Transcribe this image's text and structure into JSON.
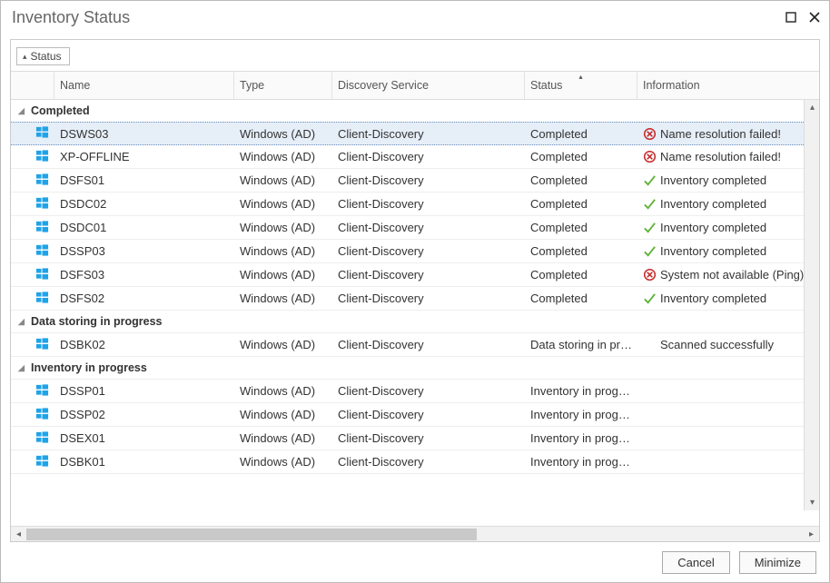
{
  "window": {
    "title": "Inventory Status"
  },
  "chip": {
    "label": "Status"
  },
  "columns": {
    "name": "Name",
    "type": "Type",
    "discovery": "Discovery Service",
    "status": "Status",
    "information": "Information"
  },
  "groups": [
    {
      "label": "Completed",
      "rows": [
        {
          "name": "DSWS03",
          "type": "Windows (AD)",
          "discovery": "Client-Discovery",
          "status": "Completed",
          "info_kind": "error",
          "info": "Name resolution failed!",
          "selected": true
        },
        {
          "name": "XP-OFFLINE",
          "type": "Windows (AD)",
          "discovery": "Client-Discovery",
          "status": "Completed",
          "info_kind": "error",
          "info": "Name resolution failed!"
        },
        {
          "name": "DSFS01",
          "type": "Windows (AD)",
          "discovery": "Client-Discovery",
          "status": "Completed",
          "info_kind": "ok",
          "info": "Inventory completed"
        },
        {
          "name": "DSDC02",
          "type": "Windows (AD)",
          "discovery": "Client-Discovery",
          "status": "Completed",
          "info_kind": "ok",
          "info": "Inventory completed"
        },
        {
          "name": "DSDC01",
          "type": "Windows (AD)",
          "discovery": "Client-Discovery",
          "status": "Completed",
          "info_kind": "ok",
          "info": "Inventory completed"
        },
        {
          "name": "DSSP03",
          "type": "Windows (AD)",
          "discovery": "Client-Discovery",
          "status": "Completed",
          "info_kind": "ok",
          "info": "Inventory completed"
        },
        {
          "name": "DSFS03",
          "type": "Windows (AD)",
          "discovery": "Client-Discovery",
          "status": "Completed",
          "info_kind": "error",
          "info": "System not available (Ping)"
        },
        {
          "name": "DSFS02",
          "type": "Windows (AD)",
          "discovery": "Client-Discovery",
          "status": "Completed",
          "info_kind": "ok",
          "info": "Inventory completed"
        }
      ]
    },
    {
      "label": "Data storing in progress",
      "rows": [
        {
          "name": "DSBK02",
          "type": "Windows (AD)",
          "discovery": "Client-Discovery",
          "status": "Data storing in pr…",
          "info_kind": "none",
          "info": "Scanned successfully"
        }
      ]
    },
    {
      "label": "Inventory in progress",
      "rows": [
        {
          "name": "DSSP01",
          "type": "Windows (AD)",
          "discovery": "Client-Discovery",
          "status": "Inventory in progr…",
          "info_kind": "none",
          "info": ""
        },
        {
          "name": "DSSP02",
          "type": "Windows (AD)",
          "discovery": "Client-Discovery",
          "status": "Inventory in progr…",
          "info_kind": "none",
          "info": ""
        },
        {
          "name": "DSEX01",
          "type": "Windows (AD)",
          "discovery": "Client-Discovery",
          "status": "Inventory in progr…",
          "info_kind": "none",
          "info": ""
        },
        {
          "name": "DSBK01",
          "type": "Windows (AD)",
          "discovery": "Client-Discovery",
          "status": "Inventory in progr…",
          "info_kind": "none",
          "info": ""
        }
      ]
    }
  ],
  "footer": {
    "cancel": "Cancel",
    "minimize": "Minimize"
  }
}
